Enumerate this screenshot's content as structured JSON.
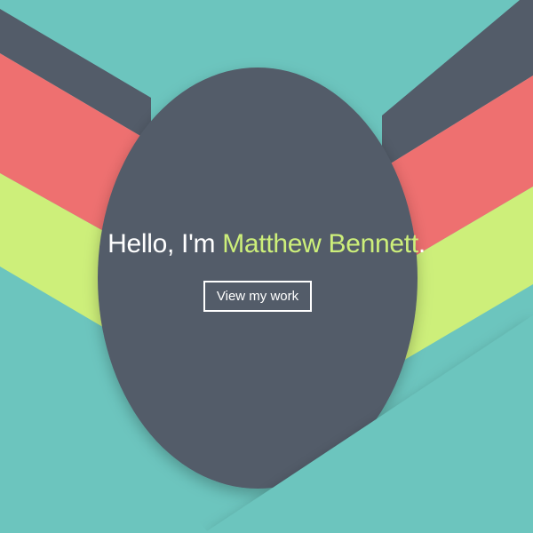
{
  "hero": {
    "greeting": "Hello, I'm ",
    "name": "Matthew Bennett",
    "punctuation": ".",
    "cta_label": "View my work"
  },
  "colors": {
    "background": "#6cc5be",
    "slate": "#535c69",
    "coral": "#ee7070",
    "lime": "#cdef7a",
    "text": "#ffffff"
  }
}
